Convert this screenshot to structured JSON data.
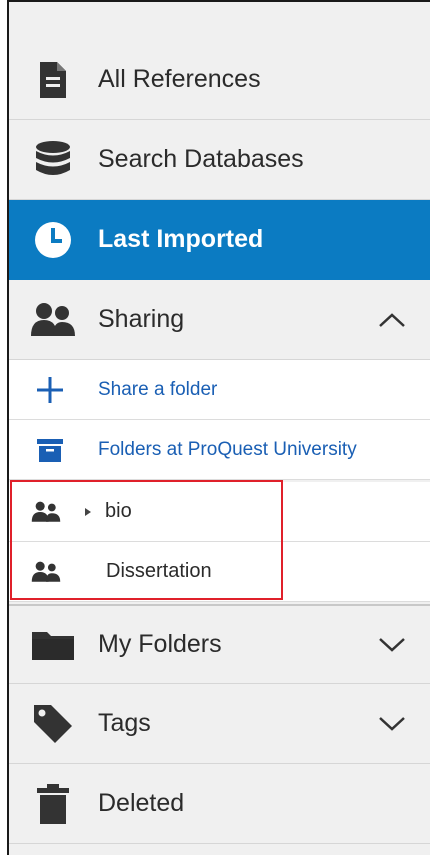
{
  "nav": {
    "all_references": {
      "label": "All References",
      "icon": "document-icon"
    },
    "search_databases": {
      "label": "Search Databases",
      "icon": "database-icon"
    },
    "last_imported": {
      "label": "Last Imported",
      "icon": "clock-icon"
    },
    "sharing": {
      "label": "Sharing",
      "icon": "users-icon",
      "expanded": true
    },
    "my_folders": {
      "label": "My Folders",
      "icon": "folder-icon",
      "expanded": false
    },
    "tags": {
      "label": "Tags",
      "icon": "tag-icon",
      "expanded": false
    },
    "deleted": {
      "label": "Deleted",
      "icon": "trash-icon"
    }
  },
  "sharing_items": {
    "share_folder": {
      "label": "Share a folder",
      "icon": "plus-icon"
    },
    "folders_at": {
      "label": "Folders at ProQuest University",
      "icon": "archive-box-icon"
    }
  },
  "shared_folders": [
    {
      "label": "bio",
      "has_children": true,
      "icon": "users-icon"
    },
    {
      "label": "Dissertation",
      "has_children": false,
      "icon": "users-icon"
    }
  ],
  "colors": {
    "active_bg": "#0b7bc2",
    "link": "#1a5fb4",
    "highlight_border": "#e0202a",
    "panel_bg": "#f0f0f0"
  }
}
